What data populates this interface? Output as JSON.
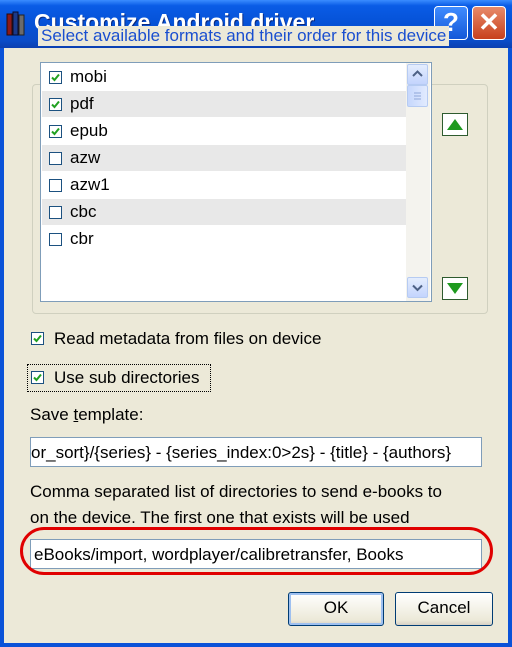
{
  "window": {
    "title": "Customize Android driver",
    "help_glyph": "?",
    "close_glyph": "✕"
  },
  "formats": {
    "group_title": "Select available formats and their order for this device",
    "items": [
      {
        "label": "mobi",
        "checked": true
      },
      {
        "label": "pdf",
        "checked": true
      },
      {
        "label": "epub",
        "checked": true
      },
      {
        "label": "azw",
        "checked": false
      },
      {
        "label": "azw1",
        "checked": false
      },
      {
        "label": "cbc",
        "checked": false
      },
      {
        "label": "cbr",
        "checked": false
      }
    ]
  },
  "options": {
    "read_metadata": {
      "label": "Read metadata from files on device",
      "checked": true
    },
    "use_subdirs": {
      "label": "Use sub directories",
      "checked": true
    }
  },
  "save_template": {
    "label_pre": "Save ",
    "label_mnemonic": "t",
    "label_post": "emplate:",
    "value": "or_sort}/{series} - {series_index:0>2s} - {title} - {authors}"
  },
  "directories": {
    "hint_line1": "Comma separated list of directories to send e-books to",
    "hint_line2": "on the device. The first one that exists will be used",
    "value": "eBooks/import, wordplayer/calibretransfer, Books"
  },
  "buttons": {
    "ok": "OK",
    "cancel": "Cancel"
  },
  "colors": {
    "title_bar": "#0551d6",
    "group_title": "#1a4fd0",
    "highlight_ellipse": "#e00000",
    "move_arrow": "#1e9a1e"
  }
}
